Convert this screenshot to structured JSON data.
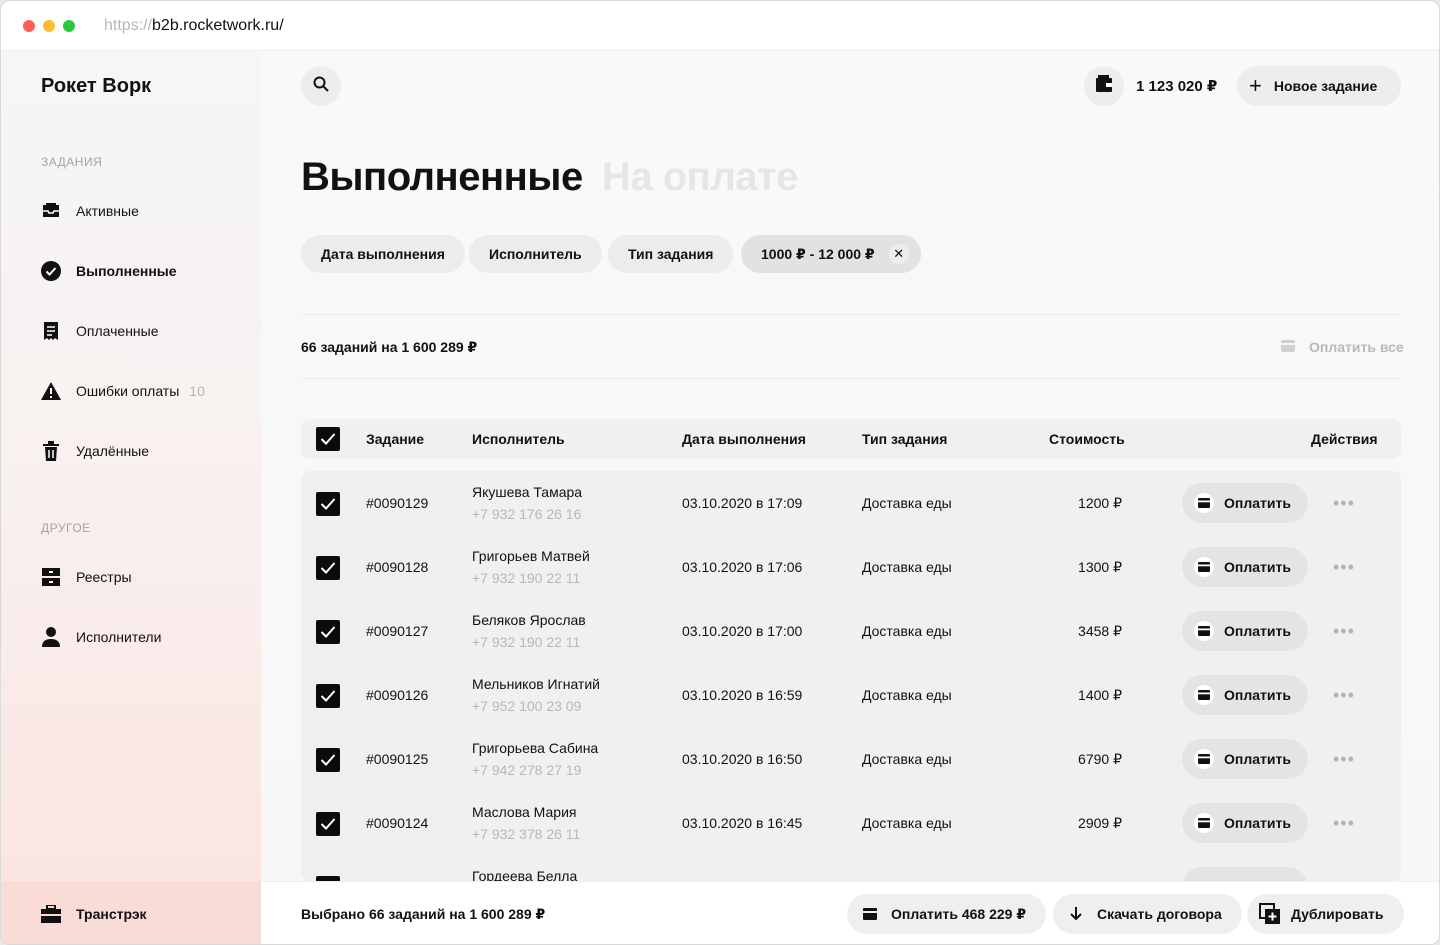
{
  "browser": {
    "url_scheme": "https://",
    "url_host": "b2b.rocketwork.ru/"
  },
  "sidebar": {
    "brand": "Рокет Ворк",
    "sections": [
      {
        "label": "ЗАДАНИЯ",
        "items": [
          {
            "label": "Активные",
            "icon": "inbox-icon"
          },
          {
            "label": "Выполненные",
            "icon": "check-circle-icon",
            "active": true
          },
          {
            "label": "Оплаченные",
            "icon": "receipt-icon"
          },
          {
            "label": "Ошибки оплаты",
            "icon": "warning-icon",
            "count": "10"
          },
          {
            "label": "Удалённые",
            "icon": "trash-icon"
          }
        ]
      },
      {
        "label": "ДРУГОЕ",
        "items": [
          {
            "label": "Реестры",
            "icon": "drawer-icon"
          },
          {
            "label": "Исполнители",
            "icon": "user-icon"
          }
        ]
      }
    ],
    "footer": {
      "label": "Транстрэк",
      "icon": "briefcase-icon"
    }
  },
  "header": {
    "balance": "1 123 020 ₽",
    "new_task_label": "Новое задание"
  },
  "page": {
    "title": "Выполненные",
    "title_alt": "На оплате"
  },
  "filters": [
    {
      "label": "Дата выполнения"
    },
    {
      "label": "Исполнитель"
    },
    {
      "label": "Тип задания"
    },
    {
      "label": "1000 ₽ - 12 000 ₽",
      "selected": true
    }
  ],
  "summary": {
    "text": "66 заданий на 1 600 289 ₽",
    "pay_all_label": "Оплатить все"
  },
  "table": {
    "columns": [
      "Задание",
      "Исполнитель",
      "Дата выполнения",
      "Тип задания",
      "Стоимость",
      "Действия"
    ],
    "pay_label": "Оплатить",
    "rows": [
      {
        "task": "#0090129",
        "name": "Якушева Тамара",
        "phone": "+7 932 176 26 16",
        "date": "03.10.2020 в 17:09",
        "type": "Доставка еды",
        "price": "1200 ₽",
        "checked": true
      },
      {
        "task": "#0090128",
        "name": "Григорьев Матвей",
        "phone": "+7 932 190 22 11",
        "date": "03.10.2020 в 17:06",
        "type": "Доставка еды",
        "price": "1300 ₽",
        "checked": true
      },
      {
        "task": "#0090127",
        "name": "Беляков Ярослав",
        "phone": "+7 932 190 22 11",
        "date": "03.10.2020 в 17:00",
        "type": "Доставка еды",
        "price": "3458 ₽",
        "checked": true
      },
      {
        "task": "#0090126",
        "name": "Мельников Игнатий",
        "phone": "+7 952 100 23 09",
        "date": "03.10.2020 в 16:59",
        "type": "Доставка еды",
        "price": "1400 ₽",
        "checked": true
      },
      {
        "task": "#0090125",
        "name": "Григорьева Сабина",
        "phone": "+7 942 278 27 19",
        "date": "03.10.2020 в 16:50",
        "type": "Доставка еды",
        "price": "6790 ₽",
        "checked": true
      },
      {
        "task": "#0090124",
        "name": "Маслова Мария",
        "phone": "+7 932 378 26 11",
        "date": "03.10.2020 в 16:45",
        "type": "Доставка еды",
        "price": "2909 ₽",
        "checked": true
      },
      {
        "task": "",
        "name": "Гордеева Белла",
        "phone": "",
        "date": "",
        "type": "",
        "price": "",
        "checked": true
      }
    ]
  },
  "bottom_bar": {
    "selected_text": "Выбрано 66 заданий на 1 600 289 ₽",
    "pay_label": "Оплатить 468 229 ₽",
    "download_label": "Скачать договора",
    "duplicate_label": "Дублировать"
  }
}
